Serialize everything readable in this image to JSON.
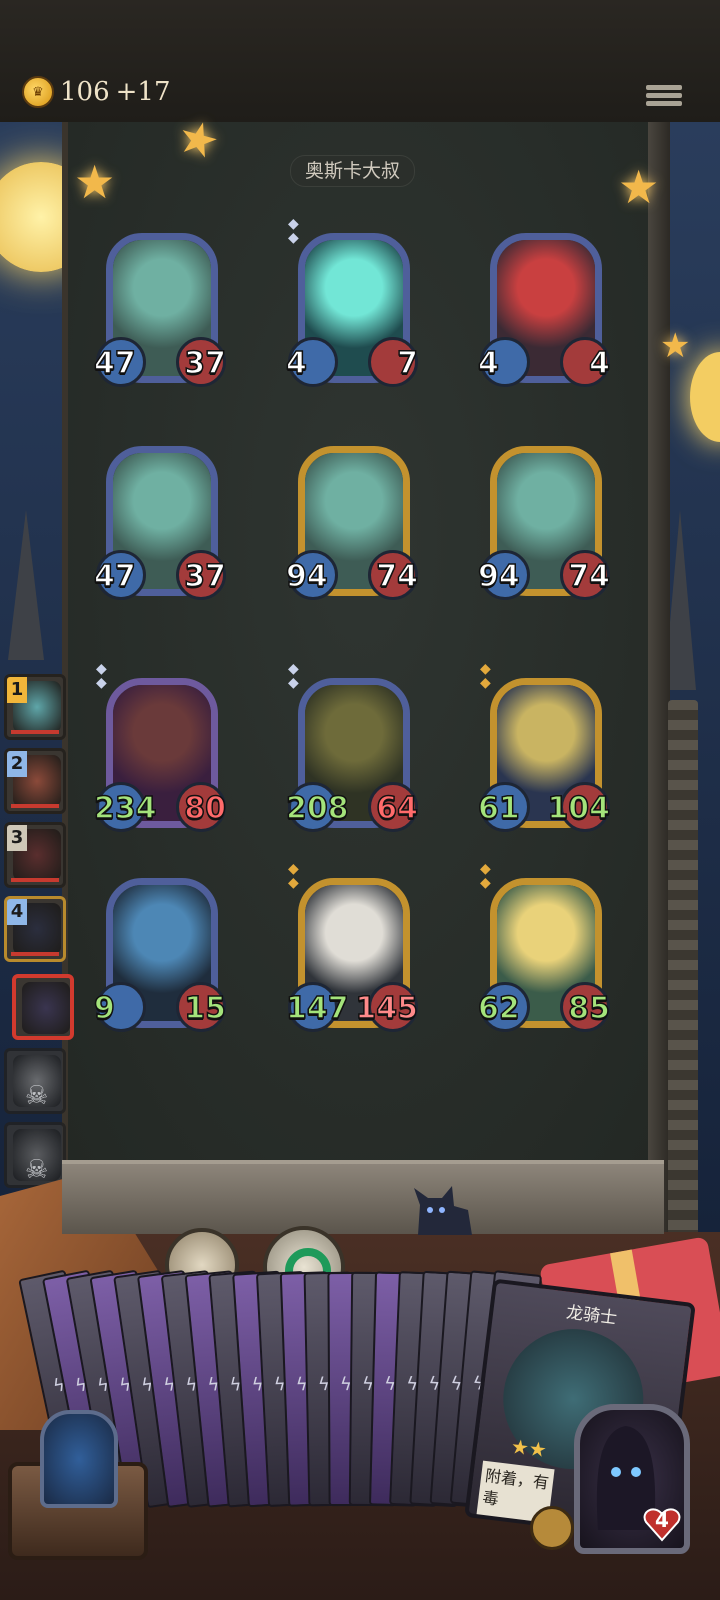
{
  "header": {
    "gold": "106",
    "gold_income": "+17"
  },
  "opponent": {
    "name": "奥斯卡大叔"
  },
  "board": [
    {
      "id": "m1",
      "atk": "47",
      "hp": "37",
      "frame": "blue",
      "art": "teal-dragon",
      "tier": "none"
    },
    {
      "id": "m2",
      "atk": "4",
      "hp": "7",
      "frame": "blue",
      "art": "ghost-warrior",
      "tier": "blue-gem"
    },
    {
      "id": "m3",
      "atk": "4",
      "hp": "4",
      "frame": "blue",
      "art": "clown",
      "tier": "none"
    },
    {
      "id": "m4",
      "atk": "47",
      "hp": "37",
      "frame": "blue",
      "art": "teal-dragon",
      "tier": "none"
    },
    {
      "id": "m5",
      "atk": "94",
      "hp": "74",
      "frame": "gold",
      "art": "teal-dragon",
      "tier": "none"
    },
    {
      "id": "m6",
      "atk": "94",
      "hp": "74",
      "frame": "gold",
      "art": "teal-dragon",
      "tier": "none"
    },
    {
      "id": "m7",
      "atk": "234",
      "hp": "80",
      "frame": "purple",
      "art": "boar",
      "tier": "blue-gem"
    },
    {
      "id": "m8",
      "atk": "208",
      "hp": "64",
      "frame": "blue",
      "art": "wizard",
      "tier": "blue-gem"
    },
    {
      "id": "m9",
      "atk": "61",
      "hp": "104",
      "frame": "gold",
      "art": "knight",
      "tier": "gold-gem"
    },
    {
      "id": "m10",
      "atk": "9",
      "hp": "15",
      "frame": "blue",
      "art": "elf-woman",
      "tier": "none"
    },
    {
      "id": "m11",
      "atk": "147",
      "hp": "145",
      "frame": "gold",
      "art": "dog",
      "tier": "gold-gem"
    },
    {
      "id": "m12",
      "atk": "62",
      "hp": "85",
      "frame": "gold",
      "art": "fairy",
      "tier": "gold-gem"
    }
  ],
  "leaderboard": [
    {
      "rank": "1",
      "state": "alive"
    },
    {
      "rank": "2",
      "state": "alive"
    },
    {
      "rank": "3",
      "state": "alive"
    },
    {
      "rank": "4",
      "state": "alive"
    },
    {
      "rank": "",
      "state": "active"
    },
    {
      "rank": "",
      "state": "dead"
    },
    {
      "rank": "",
      "state": "dead"
    },
    {
      "rank": "",
      "state": "dead"
    }
  ],
  "featured_card": {
    "name": "龙骑士",
    "text": "附着，有毒",
    "stars": "★★"
  },
  "hero": {
    "hp": "4"
  },
  "colors": {
    "accent": "#c3922e",
    "buff": "#a4e37b",
    "damage": "#ff8a8a",
    "active_border": "#d23a2e"
  }
}
